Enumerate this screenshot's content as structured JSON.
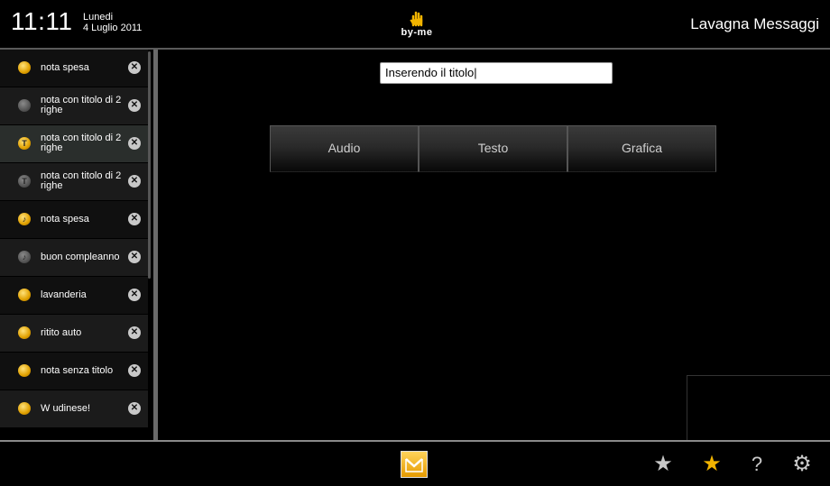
{
  "header": {
    "time": "11:11",
    "weekday": "Lunedi",
    "date": "4 Luglio 2011",
    "logo_text": "by-me",
    "app_title": "Lavagna Messaggi"
  },
  "notes": [
    {
      "label": "nota spesa",
      "icon": "pencil-icon",
      "icon_char": "",
      "color": "gold"
    },
    {
      "label": "nota con titolo di 2 righe",
      "icon": "pencil-icon",
      "icon_char": "",
      "color": "grey"
    },
    {
      "label": "nota con titolo di 2 righe",
      "icon": "text-icon",
      "icon_char": "T",
      "color": "gold"
    },
    {
      "label": "nota con titolo di 2 righe",
      "icon": "text-icon",
      "icon_char": "T",
      "color": "grey"
    },
    {
      "label": "nota spesa",
      "icon": "music-note-icon",
      "icon_char": "♪",
      "color": "gold"
    },
    {
      "label": "buon compleanno",
      "icon": "music-note-icon",
      "icon_char": "♪",
      "color": "grey"
    },
    {
      "label": "lavanderia",
      "icon": "pencil-icon",
      "icon_char": "",
      "color": "gold"
    },
    {
      "label": "ritito auto",
      "icon": "pencil-icon",
      "icon_char": "",
      "color": "gold"
    },
    {
      "label": "nota senza titolo",
      "icon": "pencil-icon",
      "icon_char": "",
      "color": "gold"
    },
    {
      "label": "W udinese!",
      "icon": "pencil-icon",
      "icon_char": "",
      "color": "gold"
    }
  ],
  "editor": {
    "title_value": "Inserendo il titolo|"
  },
  "tabs": [
    "Audio",
    "Testo",
    "Grafica"
  ],
  "footer": {
    "icons": [
      "message-board-icon",
      "star-icon",
      "add-star-icon",
      "help-icon",
      "settings-icon"
    ],
    "help_char": "?"
  },
  "colors": {
    "accent": "#f2b400",
    "background": "#000000"
  }
}
